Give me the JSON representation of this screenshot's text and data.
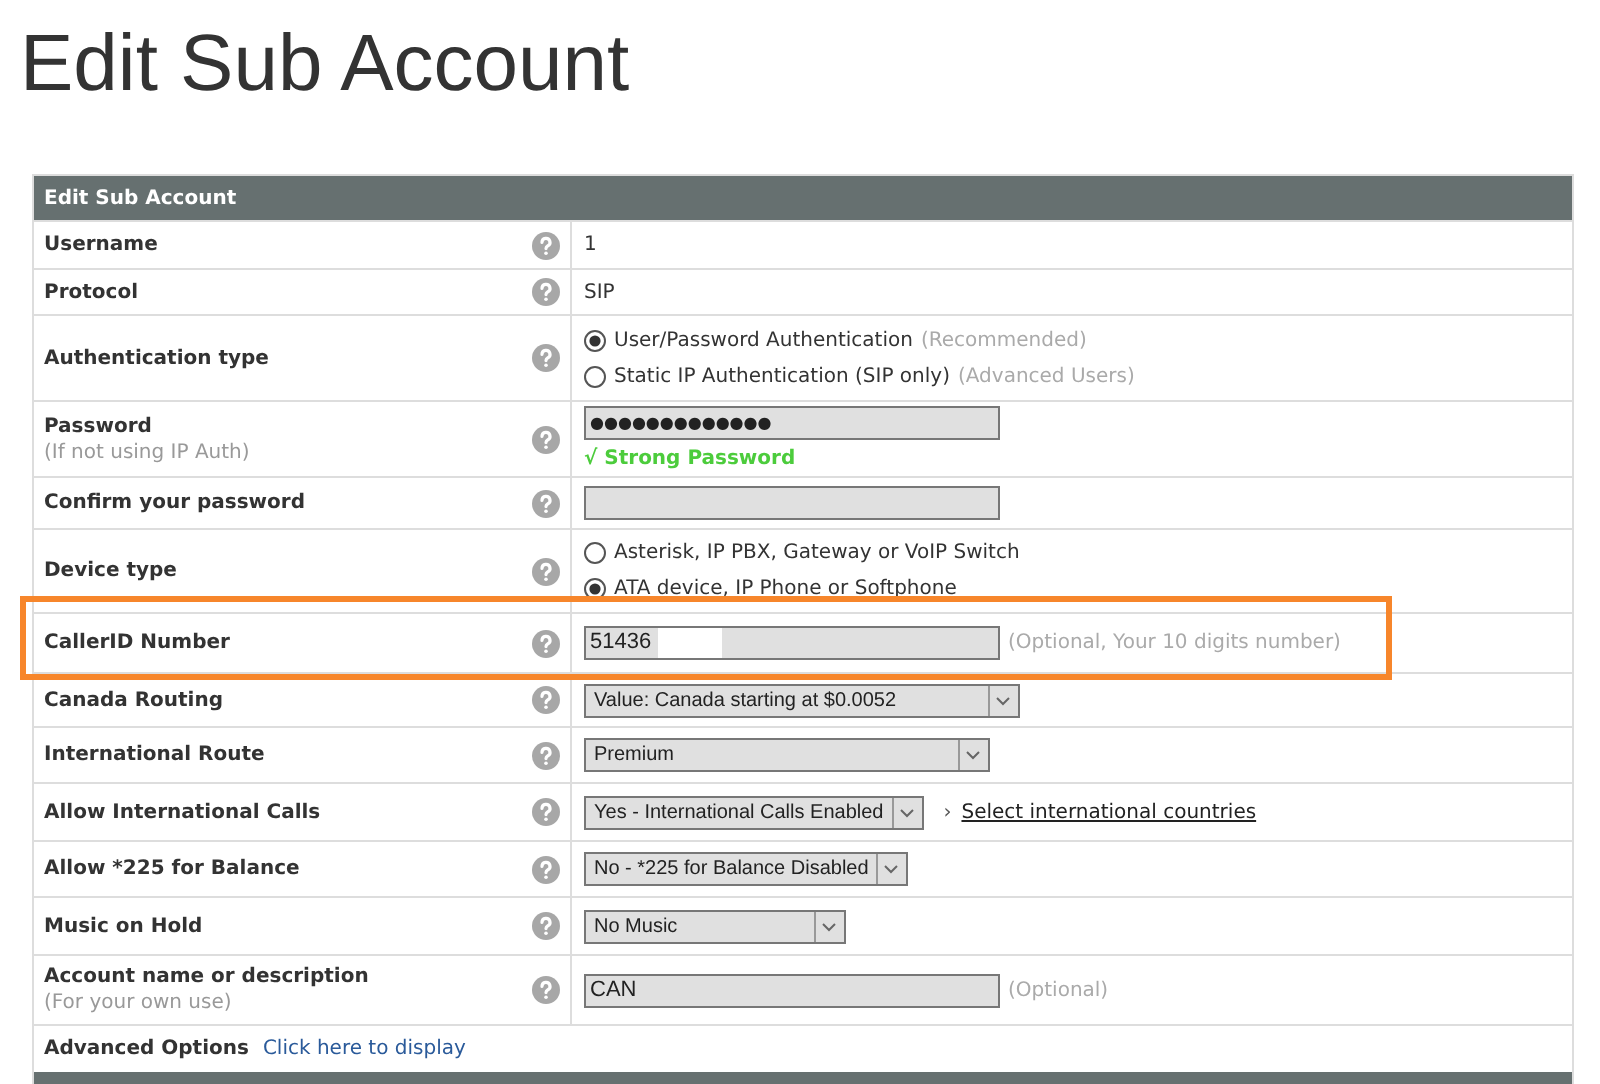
{
  "page_title": "Edit Sub Account",
  "form": {
    "header": "Edit Sub Account",
    "rows": [
      {
        "kind": "text",
        "label": "Username",
        "value": "1"
      },
      {
        "kind": "text",
        "label": "Protocol",
        "value": "SIP"
      },
      {
        "kind": "radio",
        "label": "Authentication type",
        "options": [
          {
            "label": "User/Password Authentication",
            "note": "(Recommended)",
            "selected": true
          },
          {
            "label": "Static IP Authentication (SIP only)",
            "note": "(Advanced Users)",
            "selected": false
          }
        ]
      },
      {
        "kind": "password",
        "label": "Password",
        "sublabel": "(If not using IP Auth)",
        "value": "●●●●●●●●●●●●●",
        "strength": "√ Strong Password"
      },
      {
        "kind": "password",
        "label": "Confirm your password",
        "value": ""
      },
      {
        "kind": "radio",
        "label": "Device type",
        "options": [
          {
            "label": "Asterisk, IP PBX, Gateway or VoIP Switch",
            "selected": false
          },
          {
            "label": "ATA device, IP Phone or Softphone",
            "selected": true
          }
        ]
      },
      {
        "kind": "input",
        "label": "CallerID Number",
        "value": "51436",
        "note": "(Optional, Your 10 digits number)",
        "highlighted": true,
        "redacted": true
      },
      {
        "kind": "select",
        "label": "Canada Routing",
        "value": "Value: Canada starting at $0.0052"
      },
      {
        "kind": "select",
        "label": "International Route",
        "value": "Premium"
      },
      {
        "kind": "select",
        "label": "Allow International Calls",
        "value": "Yes - International Calls Enabled",
        "chevron": "›",
        "link": "Select international countries"
      },
      {
        "kind": "select",
        "label": "Allow *225 for Balance",
        "value": "No - *225 for Balance Disabled"
      },
      {
        "kind": "select",
        "label": "Music on Hold",
        "value": "No Music"
      },
      {
        "kind": "input",
        "label": "Account name or description",
        "sublabel": "(For your own use)",
        "value": "CAN",
        "note": "(Optional)",
        "highlighted": false,
        "redacted": false
      },
      {
        "kind": "advanced",
        "label": "Advanced Options",
        "link": "Click here to display"
      }
    ]
  }
}
